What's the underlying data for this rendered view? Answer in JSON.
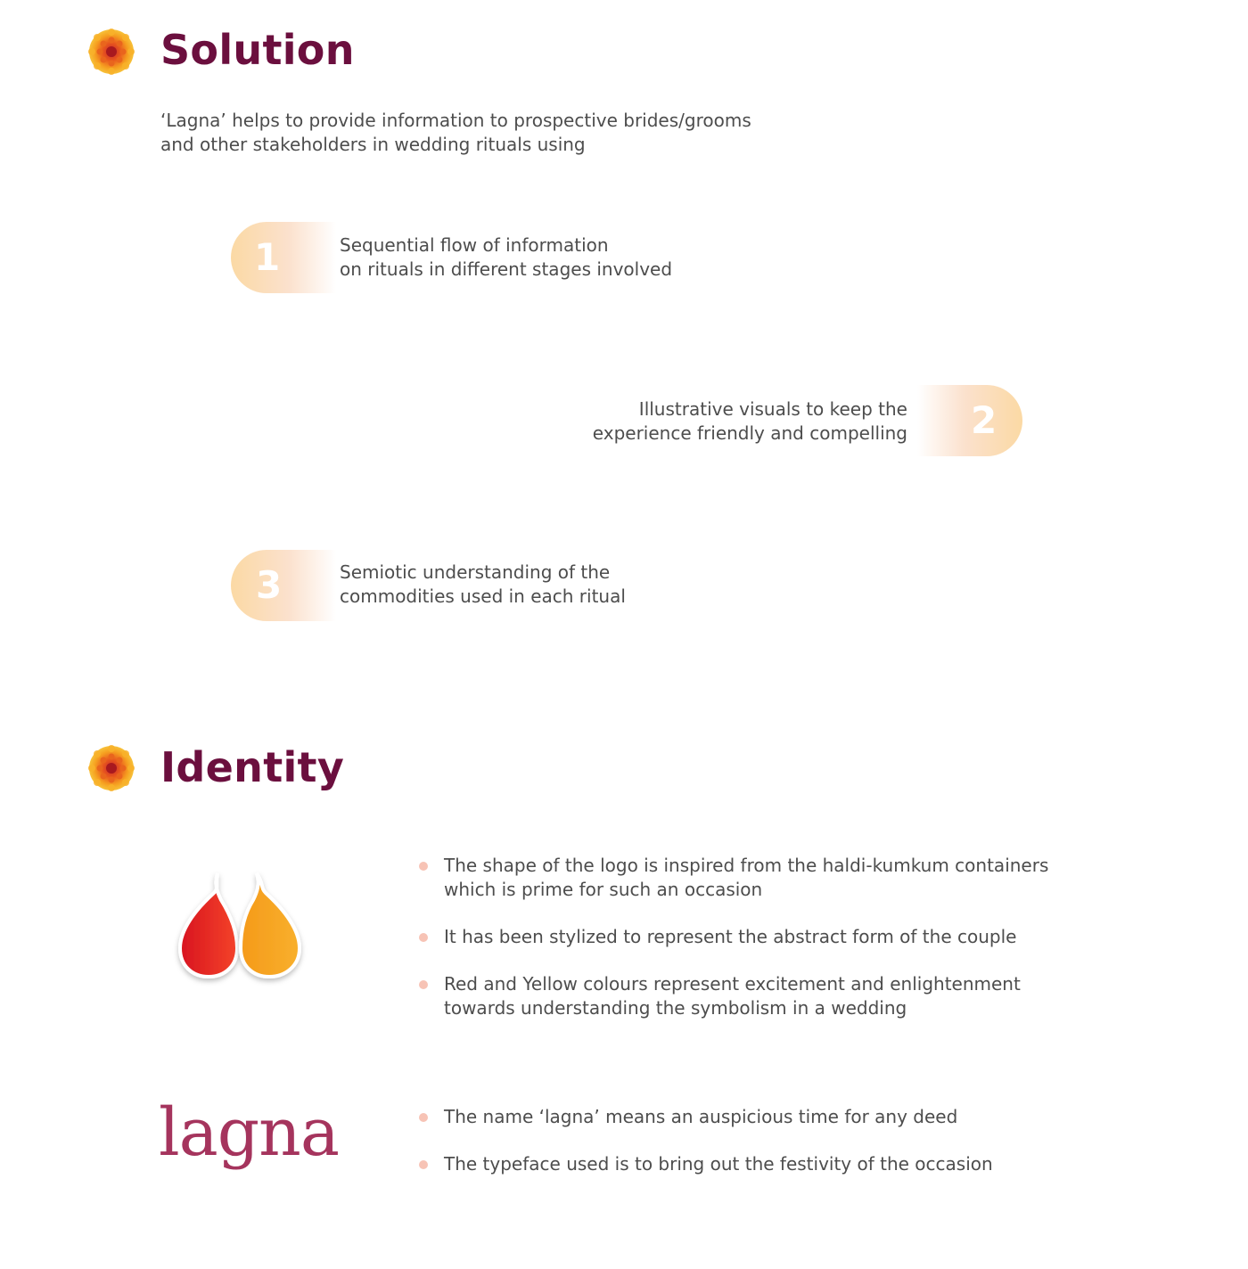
{
  "solution": {
    "heading": "Solution",
    "intro": "‘Lagna’ helps to provide information to prospective brides/grooms and other stakeholders in wedding rituals using",
    "steps": [
      {
        "number": "1",
        "line1": "Sequential flow of information",
        "line2": "on rituals in different stages involved"
      },
      {
        "number": "2",
        "line1": "Illustrative visuals to keep the",
        "line2": "experience friendly and compelling"
      },
      {
        "number": "3",
        "line1": "Semiotic understanding of the",
        "line2": "commodities used in each ritual"
      }
    ]
  },
  "identity": {
    "heading": "Identity",
    "logo_bullets": [
      "The shape of the logo is inspired from the haldi-kumkum containers which is prime for such an occasion",
      "It has been stylized to represent the abstract form of the couple",
      "Red and Yellow colours represent excitement and enlightenment towards understanding the symbolism in a wedding"
    ],
    "wordmark": "lagna",
    "name_bullets": [
      "The name ‘lagna’ means an auspicious time for any deed",
      "The typeface used is to bring out the festivity of the occasion"
    ]
  },
  "colors": {
    "heading": "#6b0f3e",
    "bullet": "#f7c3b5",
    "logo_red": "#e8262a",
    "logo_yellow": "#f7a21b",
    "wordmark": "#a5345d"
  },
  "icons": [
    "marigold-flower-icon",
    "lagna-logo-drops-icon"
  ]
}
